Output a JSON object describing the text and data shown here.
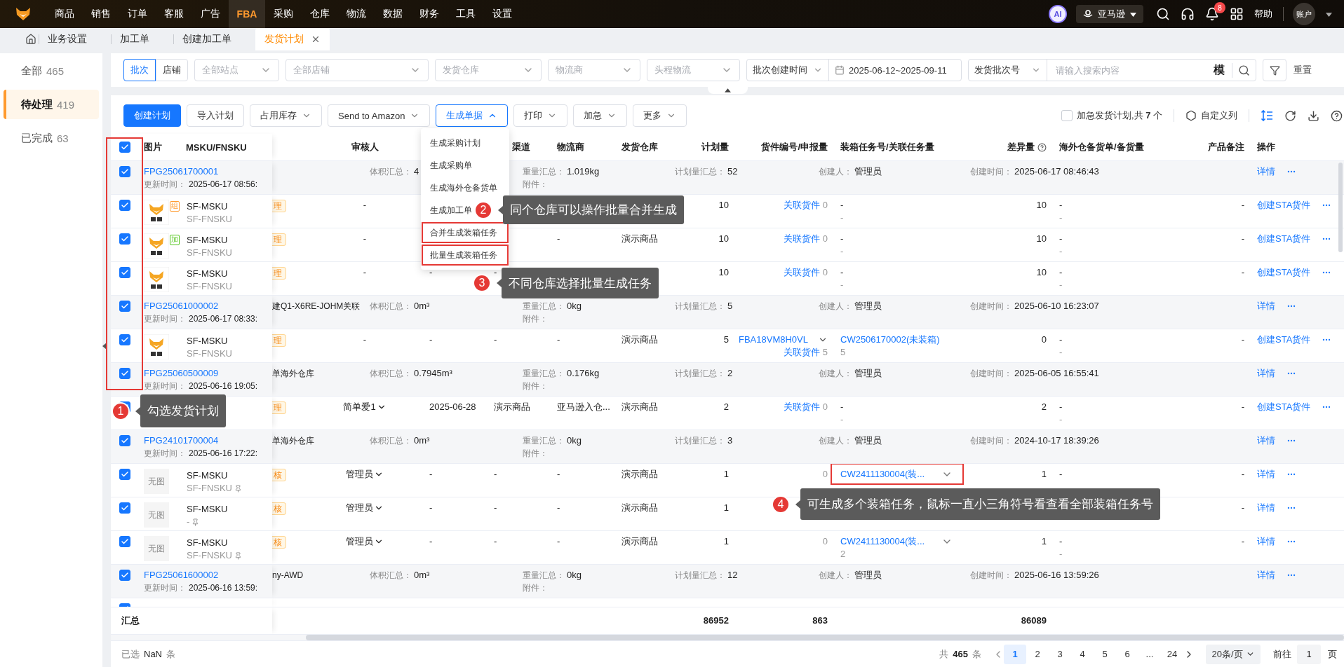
{
  "nav": {
    "items": [
      {
        "label": "商品",
        "selected": false
      },
      {
        "label": "销售",
        "selected": false
      },
      {
        "label": "订单",
        "selected": false
      },
      {
        "label": "客服",
        "selected": false
      },
      {
        "label": "广告",
        "selected": false
      },
      {
        "label": "FBA",
        "selected": true
      },
      {
        "label": "采购",
        "selected": false
      },
      {
        "label": "仓库",
        "selected": false
      },
      {
        "label": "物流",
        "selected": false
      },
      {
        "label": "数据",
        "selected": false
      },
      {
        "label": "财务",
        "selected": false
      },
      {
        "label": "工具",
        "selected": false
      },
      {
        "label": "设置",
        "selected": false
      }
    ],
    "ai": "AI",
    "marketplace": "亚马逊",
    "notification_count": "8",
    "help": "帮助",
    "account": "账户"
  },
  "tabs": [
    {
      "label": "业务设置",
      "selected": false
    },
    {
      "label": "加工单",
      "selected": false
    },
    {
      "label": "创建加工单",
      "selected": false
    },
    {
      "label": "发货计划",
      "selected": true
    }
  ],
  "sidebar": {
    "items": [
      {
        "label": "全部",
        "count": "465",
        "selected": false
      },
      {
        "label": "待处理",
        "count": "419",
        "selected": true
      },
      {
        "label": "已完成",
        "count": "63",
        "selected": false
      }
    ]
  },
  "filters": {
    "scope": [
      {
        "label": "批次",
        "selected": true
      },
      {
        "label": "店铺",
        "selected": false
      }
    ],
    "selects": [
      {
        "placeholder": "全部站点"
      },
      {
        "placeholder": "全部店铺"
      },
      {
        "placeholder": "发货仓库"
      },
      {
        "placeholder": "物流商"
      },
      {
        "placeholder": "头程物流"
      }
    ],
    "date_type": "批次创建时间",
    "date_range": "2025-06-12~2025-09-11",
    "search_type": "发货批次号",
    "search": {
      "placeholder": "请输入搜索内容"
    },
    "fuzzy": "模",
    "reset": "重置"
  },
  "toolbar": {
    "buttons": [
      {
        "label": "创建计划",
        "kind": "primary"
      },
      {
        "label": "导入计划",
        "kind": "plain"
      },
      {
        "label": "占用库存",
        "kind": "dropdown",
        "expanded": false
      },
      {
        "label": "Send to Amazon",
        "kind": "dropdown",
        "expanded": false
      },
      {
        "label": "生成单据",
        "kind": "dropdown",
        "expanded": true
      },
      {
        "label": "打印",
        "kind": "dropdown",
        "expanded": false
      },
      {
        "label": "加急",
        "kind": "dropdown",
        "expanded": false
      },
      {
        "label": "更多",
        "kind": "dropdown",
        "expanded": false
      }
    ],
    "urgent": {
      "label": "加急发货计划,共 **7** 个",
      "checked": false
    },
    "custom_columns": "自定义列"
  },
  "menu": {
    "items": [
      {
        "label": "生成采购计划",
        "outlined": false
      },
      {
        "label": "生成采购单",
        "outlined": false
      },
      {
        "label": "生成海外仓备货单",
        "outlined": false
      },
      {
        "label": "生成加工单",
        "outlined": false
      },
      {
        "label": "合并生成装箱任务",
        "outlined": true
      },
      {
        "label": "批量生成装箱任务",
        "outlined": true
      }
    ]
  },
  "table": {
    "header_checked": true,
    "checkbox_column_outlined": true,
    "image_header": "图片",
    "sku_header": "MSKU/FNSKU",
    "columns": [
      {
        "label": "审核人"
      },
      {
        "label": "渠道"
      },
      {
        "label": "物流商"
      },
      {
        "label": "发货仓库"
      },
      {
        "label": "计划量"
      },
      {
        "label": "货件编号/申报量"
      },
      {
        "label": "装箱任务号/关联任务量"
      },
      {
        "label": "差异量",
        "info_icon": true
      },
      {
        "label": "海外仓备货单/备货量"
      },
      {
        "label": "产品备注"
      },
      {
        "label": "操作"
      }
    ],
    "rows": [
      {
        "kind": "group",
        "checked": true,
        "batch": "FPG25061700001",
        "updated_label": "更新时间：",
        "updated": "2025-06-17 08:56:",
        "volume_label": "体积汇总：",
        "volume": "4",
        "weight_label": "重量汇总：",
        "weight": "1.019kg",
        "attachment_label": "附件：",
        "plan_label": "计划量汇总：",
        "plan": "52",
        "creator_label": "创建人：",
        "creator": "管理员",
        "created_label": "创建时间：",
        "created": "2025-06-17 08:46:43",
        "action": "详情"
      },
      {
        "kind": "product",
        "checked": true,
        "picture": true,
        "badge": {
          "label": "组",
          "color": "#ff9a2e"
        },
        "msku": "SF-MSKU",
        "fnsku": "SF-FNSKU",
        "status": "理",
        "reviewer": "-",
        "plan": "10",
        "linked_label": "关联货件",
        "linked_count": "0",
        "box_task": "-",
        "box_count": "-",
        "diff": "10",
        "overseas": "-",
        "overseas_qty": "-",
        "remark": "-",
        "action": "创建STA货件"
      },
      {
        "kind": "product",
        "checked": true,
        "picture": true,
        "badge": {
          "label": "加",
          "color": "#52c41a"
        },
        "msku": "SF-MSKU",
        "fnsku": "SF-FNSKU",
        "status": "理",
        "reviewer": "-",
        "carrier": "-",
        "warehouse": "演示商品",
        "plan": "10",
        "linked_label": "关联货件",
        "linked_count": "0",
        "box_task": "-",
        "box_count": "-",
        "diff": "10",
        "overseas": "-",
        "overseas_qty": "-",
        "remark": "-",
        "action": "创建STA货件"
      },
      {
        "kind": "product",
        "checked": true,
        "picture": true,
        "msku": "SF-MSKU",
        "fnsku": "SF-FNSKU",
        "status": "理",
        "reviewer": "-",
        "col_3": "-",
        "channel": "-",
        "plan": "10",
        "linked_label": "关联货件",
        "linked_count": "0",
        "box_task": "-",
        "box_count": "-",
        "diff": "10",
        "overseas": "-",
        "overseas_qty": "-",
        "remark": "-",
        "action": "创建STA货件"
      },
      {
        "kind": "group",
        "checked": true,
        "batch": "FPG25061000002",
        "updated_label": "更新时间：",
        "updated": "2025-06-17 08:33:",
        "remark": "建Q1-X6RE-JOHM关联",
        "volume_label": "体积汇总：",
        "volume": "0m³",
        "weight_label": "重量汇总：",
        "weight": "0kg",
        "attachment_label": "附件：",
        "plan_label": "计划量汇总：",
        "plan": "5",
        "creator_label": "创建人：",
        "creator": "管理员",
        "created_label": "创建时间：",
        "created": "2025-06-10 16:23:07",
        "action": "详情"
      },
      {
        "kind": "product",
        "checked": true,
        "picture": true,
        "msku": "SF-MSKU",
        "fnsku": "SF-FNSKU",
        "status": "理",
        "reviewer": "-",
        "col_3": "-",
        "channel": "-",
        "carrier": "-",
        "warehouse": "演示商品",
        "plan": "5",
        "shipment": "FBA18VM8H0VL",
        "linked_label": "关联货件",
        "linked_count": "5",
        "box_task": "CW2506170002(未装箱)",
        "box_task_link": true,
        "box_count": "5",
        "diff": "0",
        "overseas": "-",
        "overseas_qty": "-",
        "remark": "-",
        "action": "创建STA货件"
      },
      {
        "kind": "group",
        "checked": true,
        "batch": "FPG25060500009",
        "updated_label": "更新时间：",
        "updated": "2025-06-16 19:05:",
        "remark": "单海外仓库",
        "volume_label": "体积汇总：",
        "volume": "0.7945m³",
        "weight_label": "重量汇总：",
        "weight": "0.176kg",
        "attachment_label": "附件：",
        "plan_label": "计划量汇总：",
        "plan": "2",
        "creator_label": "创建人：",
        "creator": "管理员",
        "created_label": "创建时间：",
        "created": "2025-06-05 16:55:41",
        "action": "详情"
      },
      {
        "kind": "product",
        "checked": true,
        "status": "理",
        "reviewer": "简单爱1",
        "reviewer_menu": true,
        "col_3": "2025-06-28",
        "channel": "演示商品",
        "carrier": "亚马逊入仓...",
        "warehouse": "演示商品",
        "plan": "2",
        "linked_label": "关联货件",
        "linked_count": "0",
        "box_task": "-",
        "box_count": "-",
        "diff": "2",
        "overseas": "-",
        "overseas_qty": "-",
        "remark": "-",
        "action": "创建STA货件"
      },
      {
        "kind": "group",
        "checked": true,
        "batch": "FPG24101700004",
        "updated_label": "更新时间：",
        "updated": "2025-06-16 17:22:",
        "remark": "单海外仓库",
        "volume_label": "体积汇总：",
        "volume": "0m³",
        "weight_label": "重量汇总：",
        "weight": "0kg",
        "attachment_label": "附件：",
        "plan_label": "计划量汇总：",
        "plan": "3",
        "creator_label": "创建人：",
        "creator": "管理员",
        "created_label": "创建时间：",
        "created": "2024-10-17 18:39:26",
        "action": "详情"
      },
      {
        "kind": "product",
        "checked": true,
        "image_text": "无图",
        "msku": "SF-MSKU",
        "fnsku": "SF-FNSKU",
        "pinned": true,
        "status": "核",
        "reviewer": "管理员",
        "reviewer_menu": true,
        "col_3": "-",
        "channel": "-",
        "carrier": "-",
        "warehouse": "演示商品",
        "plan": "1",
        "linked_count": "0",
        "box_task": "CW2411130004(装...",
        "box_task_link": true,
        "box_task_menu": true,
        "box_task_outlined": true,
        "diff": "1",
        "overseas": "-",
        "remark": "-",
        "action": "详情"
      },
      {
        "kind": "product",
        "checked": true,
        "image_text": "无图",
        "msku": "SF-MSKU",
        "fnsku": "-",
        "pinned": true,
        "status": "核",
        "reviewer": "管理员",
        "reviewer_menu": true,
        "col_3": "-",
        "channel": "-",
        "carrier": "-",
        "warehouse": "演示商品",
        "plan": "1",
        "remark": "-",
        "action": "详情"
      },
      {
        "kind": "product",
        "checked": true,
        "image_text": "无图",
        "msku": "SF-MSKU",
        "fnsku": "SF-FNSKU",
        "pinned": true,
        "status": "核",
        "reviewer": "管理员",
        "reviewer_menu": true,
        "col_3": "-",
        "channel": "-",
        "carrier": "-",
        "warehouse": "演示商品",
        "plan": "1",
        "linked_count": "0",
        "box_task": "CW2411130004(装...",
        "box_task_link": true,
        "box_task_menu": true,
        "box_count": "2",
        "diff": "1",
        "overseas": "-",
        "overseas_qty": "-",
        "remark": "-",
        "action": "详情"
      },
      {
        "kind": "group",
        "checked": true,
        "batch": "FPG25061600002",
        "updated_label": "更新时间：",
        "updated": "2025-06-16 13:59:",
        "remark": "ny-AWD",
        "volume_label": "体积汇总：",
        "volume": "0m³",
        "weight_label": "重量汇总：",
        "weight": "0kg",
        "attachment_label": "附件：",
        "plan_label": "计划量汇总：",
        "plan": "12",
        "creator_label": "创建人：",
        "creator": "管理员",
        "created_label": "创建时间：",
        "created": "2025-06-16 13:59:26",
        "action": "详情"
      },
      {
        "kind": "cut",
        "checked": true
      }
    ],
    "totals": {
      "label": "汇总",
      "plan": "86952",
      "declared": "863",
      "diff": "86089"
    }
  },
  "footer": {
    "selected_label": "已选",
    "selected_count": "NaN",
    "selected_unit": "条",
    "total_prefix": "共",
    "total": "465",
    "total_unit": "条",
    "pages": [
      {
        "label": "1",
        "selected": true
      },
      {
        "label": "2",
        "selected": false
      },
      {
        "label": "3",
        "selected": false
      },
      {
        "label": "4",
        "selected": false
      },
      {
        "label": "5",
        "selected": false
      },
      {
        "label": "6",
        "selected": false
      },
      {
        "label": "...",
        "selected": false
      },
      {
        "label": "24",
        "selected": false
      }
    ],
    "page_size": "20条/页",
    "goto_label": "前往",
    "goto_value": "1",
    "goto_unit": "页"
  },
  "annotations": [
    {
      "number": "1",
      "text": "勾选发货计划"
    },
    {
      "number": "2",
      "text": "同个仓库可以操作批量合并生成"
    },
    {
      "number": "3",
      "text": "不同仓库选择批量生成任务"
    },
    {
      "number": "4",
      "text": "可生成多个装箱任务，鼠标一直小三角符号看查看全部装箱任务号"
    }
  ]
}
